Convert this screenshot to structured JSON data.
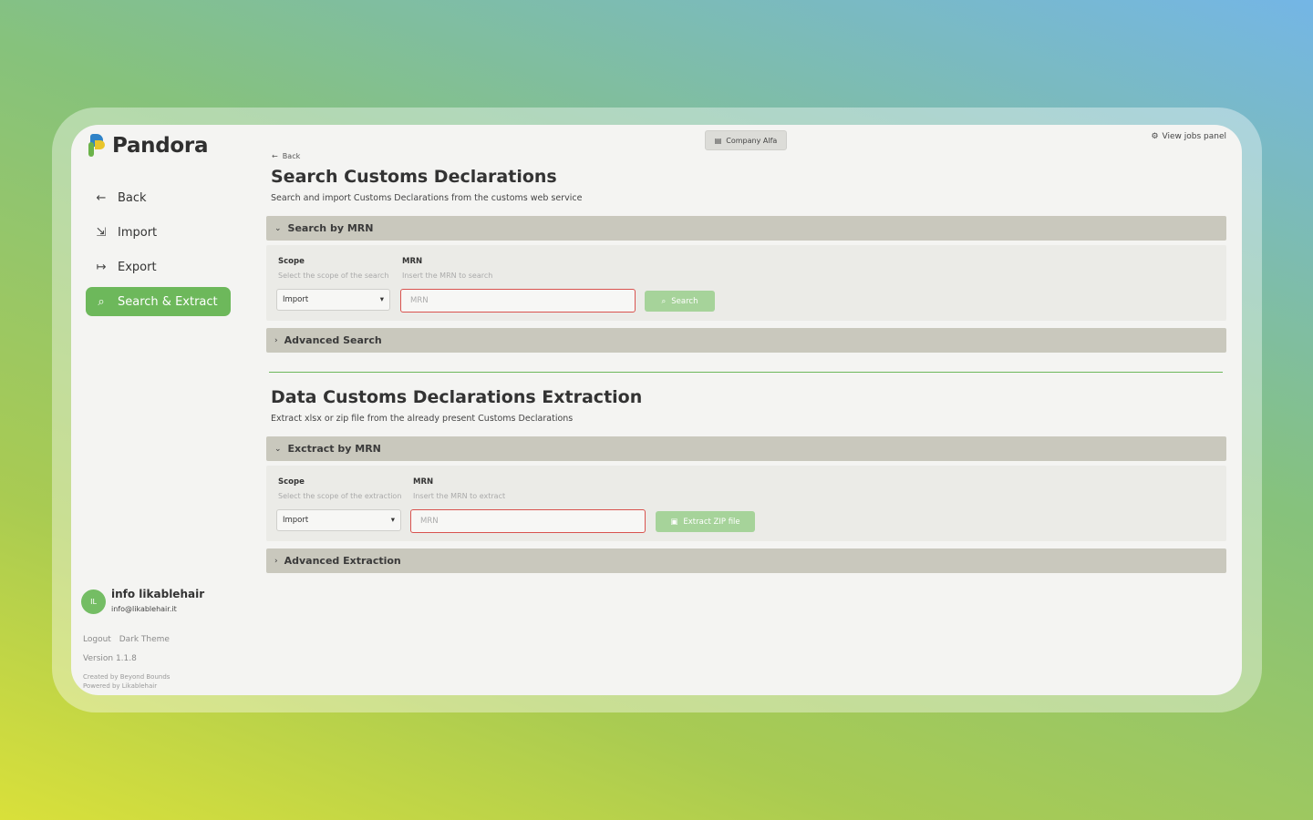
{
  "app": {
    "name": "Pandora"
  },
  "sidebar": {
    "items": [
      {
        "label": "Back",
        "icon": "arrow-left-icon"
      },
      {
        "label": "Import",
        "icon": "import-icon"
      },
      {
        "label": "Export",
        "icon": "export-icon"
      },
      {
        "label": "Search & Extract",
        "icon": "search-extract-icon",
        "active": true
      }
    ],
    "user": {
      "initials": "IL",
      "name": "info likablehair",
      "email": "info@likablehair.it"
    },
    "footer": {
      "logout": "Logout",
      "theme": "Dark Theme",
      "version": "Version 1.1.8",
      "created_by": "Created by Beyond Bounds",
      "powered_by": "Powered by Likablehair"
    }
  },
  "topbar": {
    "company": "Company Alfa",
    "jobs": "View jobs panel"
  },
  "search_section": {
    "back": "Back",
    "title": "Search Customs Declarations",
    "subtitle": "Search and import Customs Declarations from the customs web service",
    "accordion_title": "Search by MRN",
    "scope_label": "Scope",
    "scope_hint": "Select the scope of the search",
    "scope_value": "Import",
    "mrn_label": "MRN",
    "mrn_hint": "Insert the MRN to search",
    "mrn_placeholder": "MRN",
    "button": "Search",
    "advanced": "Advanced Search"
  },
  "extract_section": {
    "title": "Data Customs Declarations Extraction",
    "subtitle": "Extract xlsx or zip file from the already present Customs Declarations",
    "accordion_title": "Exctract by MRN",
    "scope_label": "Scope",
    "scope_hint": "Select the scope of the extraction",
    "scope_value": "Import",
    "mrn_label": "MRN",
    "mrn_hint": "Insert the MRN to extract",
    "mrn_placeholder": "MRN",
    "button": "Extract ZIP file",
    "advanced": "Advanced Extraction"
  },
  "colors": {
    "accent": "#6db85b",
    "accordion": "#c9c8bd",
    "error_border": "#d9534f"
  }
}
